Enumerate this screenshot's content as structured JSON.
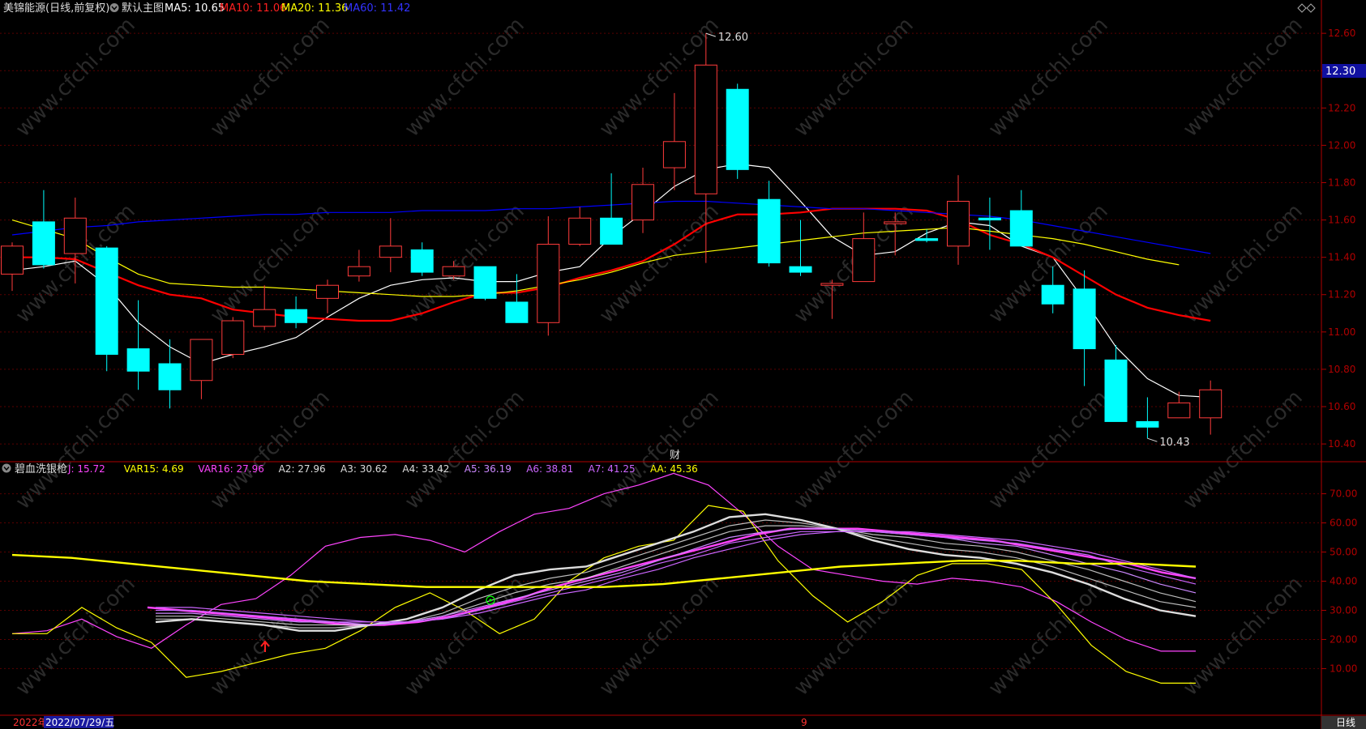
{
  "colors": {
    "bg": "#000000",
    "axis": "#b00000",
    "grid": "#5a0000",
    "up": "#ff3b3b",
    "down": "#00ffff",
    "ma5": "#ffffff",
    "ma10": "#ff0000",
    "ma20": "#ffff00",
    "ma60": "#0000ff",
    "label": "#dddddd",
    "pricebox": "#1010a0",
    "watermark": "#2a2a2a"
  },
  "watermark": "www.cfchi.com",
  "top_header": {
    "title": "美锦能源(日线,前复权)",
    "template": "默认主图",
    "ma5_text": "MA5: 10.65",
    "ma10_text": "MA10: 11.06",
    "ma20_text": "MA20: 11.36",
    "ma60_text": "MA60: 11.42"
  },
  "bottom_header": {
    "title": "碧血洗银枪",
    "items": [
      {
        "text": "J: 15.72",
        "color": "#ff44ff"
      },
      {
        "text": "VAR15: 4.69",
        "color": "#ffff00"
      },
      {
        "text": "VAR16: 27.96",
        "color": "#ff44ff"
      },
      {
        "text": "A2: 27.96",
        "color": "#dddddd"
      },
      {
        "text": "A3: 30.62",
        "color": "#dddddd"
      },
      {
        "text": "A4: 33.42",
        "color": "#dddddd"
      },
      {
        "text": "A5: 36.19",
        "color": "#cc88ff"
      },
      {
        "text": "A6: 38.81",
        "color": "#cc66ff"
      },
      {
        "text": "A7: 41.25",
        "color": "#cc66ff"
      },
      {
        "text": "AA: 45.36",
        "color": "#ffff00"
      }
    ]
  },
  "current_price_tag": "12.30",
  "high_annotation": "12.60",
  "low_annotation": "10.43",
  "cai_marker": "财",
  "date_bar": {
    "year": "2022年",
    "date": "2022/07/29/五",
    "month_marker": "9",
    "period": "日线"
  },
  "chart_data": [
    {
      "type": "candlestick",
      "title": "美锦能源(日线,前复权)",
      "y_ticks": [
        "10.40",
        "10.60",
        "10.80",
        "11.00",
        "11.20",
        "11.40",
        "11.60",
        "11.80",
        "12.00",
        "12.20",
        "12.40",
        "12.60"
      ],
      "ylim": [
        10.37,
        12.67
      ],
      "grid": true,
      "candles": [
        {
          "o": 11.31,
          "h": 11.48,
          "l": 11.22,
          "c": 11.46
        },
        {
          "o": 11.59,
          "h": 11.76,
          "l": 11.34,
          "c": 11.36
        },
        {
          "o": 11.42,
          "h": 11.72,
          "l": 11.26,
          "c": 11.61
        },
        {
          "o": 11.45,
          "h": 11.46,
          "l": 10.79,
          "c": 10.88
        },
        {
          "o": 10.91,
          "h": 11.17,
          "l": 10.69,
          "c": 10.79
        },
        {
          "o": 10.83,
          "h": 10.96,
          "l": 10.59,
          "c": 10.69
        },
        {
          "o": 10.74,
          "h": 10.96,
          "l": 10.64,
          "c": 10.96
        },
        {
          "o": 10.88,
          "h": 11.08,
          "l": 10.86,
          "c": 11.06
        },
        {
          "o": 11.03,
          "h": 11.25,
          "l": 11.01,
          "c": 11.12
        },
        {
          "o": 11.12,
          "h": 11.19,
          "l": 11.02,
          "c": 11.05
        },
        {
          "o": 11.18,
          "h": 11.28,
          "l": 11.1,
          "c": 11.25
        },
        {
          "o": 11.3,
          "h": 11.44,
          "l": 11.27,
          "c": 11.35
        },
        {
          "o": 11.4,
          "h": 11.61,
          "l": 11.32,
          "c": 11.46
        },
        {
          "o": 11.44,
          "h": 11.48,
          "l": 11.3,
          "c": 11.32
        },
        {
          "o": 11.3,
          "h": 11.38,
          "l": 11.28,
          "c": 11.35
        },
        {
          "o": 11.35,
          "h": 11.35,
          "l": 11.17,
          "c": 11.18
        },
        {
          "o": 11.16,
          "h": 11.31,
          "l": 11.05,
          "c": 11.05
        },
        {
          "o": 11.05,
          "h": 11.62,
          "l": 10.98,
          "c": 11.47
        },
        {
          "o": 11.47,
          "h": 11.67,
          "l": 11.46,
          "c": 11.61
        },
        {
          "o": 11.61,
          "h": 11.85,
          "l": 11.47,
          "c": 11.47
        },
        {
          "o": 11.6,
          "h": 11.88,
          "l": 11.53,
          "c": 11.79
        },
        {
          "o": 11.88,
          "h": 12.28,
          "l": 11.76,
          "c": 12.02
        },
        {
          "o": 11.74,
          "h": 12.6,
          "l": 11.37,
          "c": 12.43
        },
        {
          "o": 12.3,
          "h": 12.33,
          "l": 11.82,
          "c": 11.87
        },
        {
          "o": 11.71,
          "h": 11.81,
          "l": 11.35,
          "c": 11.37
        },
        {
          "o": 11.35,
          "h": 11.6,
          "l": 11.3,
          "c": 11.32
        },
        {
          "o": 11.25,
          "h": 11.28,
          "l": 11.07,
          "c": 11.26
        },
        {
          "o": 11.27,
          "h": 11.64,
          "l": 11.27,
          "c": 11.5
        },
        {
          "o": 11.58,
          "h": 11.64,
          "l": 11.41,
          "c": 11.59
        },
        {
          "o": 11.5,
          "h": 11.55,
          "l": 11.48,
          "c": 11.49
        },
        {
          "o": 11.46,
          "h": 11.84,
          "l": 11.36,
          "c": 11.7
        },
        {
          "o": 11.61,
          "h": 11.72,
          "l": 11.44,
          "c": 11.6
        },
        {
          "o": 11.65,
          "h": 11.76,
          "l": 11.46,
          "c": 11.46
        },
        {
          "o": 11.25,
          "h": 11.35,
          "l": 11.1,
          "c": 11.15
        },
        {
          "o": 11.23,
          "h": 11.33,
          "l": 10.71,
          "c": 10.91
        },
        {
          "o": 10.85,
          "h": 10.93,
          "l": 10.52,
          "c": 10.52
        },
        {
          "o": 10.52,
          "h": 10.65,
          "l": 10.43,
          "c": 10.49
        },
        {
          "o": 10.54,
          "h": 10.68,
          "l": 10.54,
          "c": 10.62
        },
        {
          "o": 10.54,
          "h": 10.74,
          "l": 10.45,
          "c": 10.69
        }
      ],
      "series": [
        {
          "name": "MA5",
          "color": "#ffffff",
          "values": [
            11.33,
            11.35,
            11.38,
            11.25,
            11.05,
            10.92,
            10.83,
            10.88,
            10.92,
            10.97,
            11.08,
            11.18,
            11.25,
            11.28,
            11.29,
            11.27,
            11.27,
            11.32,
            11.35,
            11.51,
            11.64,
            11.78,
            11.87,
            11.9,
            11.88,
            11.7,
            11.51,
            11.41,
            11.43,
            11.53,
            11.59,
            11.57,
            11.46,
            11.4,
            11.17,
            10.92,
            10.75,
            10.66,
            10.65
          ]
        },
        {
          "name": "MA10",
          "color": "#ff0000",
          "values": [
            11.4,
            11.4,
            11.39,
            11.32,
            11.25,
            11.2,
            11.18,
            11.12,
            11.1,
            11.08,
            11.07,
            11.06,
            11.06,
            11.1,
            11.16,
            11.21,
            11.21,
            11.24,
            11.29,
            11.33,
            11.38,
            11.47,
            11.58,
            11.63,
            11.63,
            11.64,
            11.66,
            11.66,
            11.66,
            11.65,
            11.6,
            11.52,
            11.47,
            11.4,
            11.3,
            11.2,
            11.13,
            11.09,
            11.06
          ]
        },
        {
          "name": "MA20",
          "color": "#ffff00",
          "values": [
            11.6,
            11.55,
            11.5,
            11.4,
            11.31,
            11.26,
            11.25,
            11.24,
            11.24,
            11.23,
            11.22,
            11.21,
            11.2,
            11.19,
            11.19,
            11.2,
            11.22,
            11.25,
            11.28,
            11.32,
            11.37,
            11.41,
            11.43,
            11.45,
            11.47,
            11.49,
            11.51,
            11.53,
            11.54,
            11.55,
            11.56,
            11.54,
            11.52,
            11.5,
            11.47,
            11.43,
            11.39,
            11.36
          ]
        },
        {
          "name": "MA60",
          "color": "#0000ff",
          "values": [
            11.52,
            11.54,
            11.56,
            11.57,
            11.59,
            11.6,
            11.61,
            11.62,
            11.63,
            11.63,
            11.64,
            11.64,
            11.64,
            11.65,
            11.65,
            11.65,
            11.66,
            11.66,
            11.67,
            11.68,
            11.69,
            11.7,
            11.7,
            11.69,
            11.68,
            11.67,
            11.66,
            11.66,
            11.65,
            11.64,
            11.63,
            11.62,
            11.6,
            11.57,
            11.54,
            11.51,
            11.48,
            11.45,
            11.42
          ]
        }
      ]
    },
    {
      "type": "line",
      "title": "碧血洗银枪",
      "y_ticks": [
        "10.00",
        "20.00",
        "30.00",
        "40.00",
        "50.00",
        "60.00",
        "70.00"
      ],
      "ylim": [
        -6,
        81
      ],
      "grid": true,
      "series": [
        {
          "name": "J",
          "color": "#ff44ff",
          "values": [
            22,
            23,
            27,
            21,
            17,
            25,
            32,
            34,
            42,
            52,
            55,
            56,
            54,
            50,
            57,
            63,
            65,
            70,
            73,
            77,
            73,
            63,
            52,
            44,
            42,
            40,
            39,
            41,
            40,
            38,
            33,
            26,
            20,
            16,
            16
          ]
        },
        {
          "name": "VAR15",
          "color": "#ffff00",
          "values": [
            22,
            22,
            31,
            24,
            19,
            7,
            9,
            12,
            15,
            17,
            23,
            31,
            36,
            30,
            22,
            27,
            40,
            48,
            52,
            54,
            66,
            64,
            47,
            35,
            26,
            33,
            42,
            46,
            46,
            44,
            32,
            18,
            9,
            5,
            5
          ]
        },
        {
          "name": "VAR16",
          "color": "#ff44ff",
          "values": [
            31,
            30,
            29,
            28,
            27,
            26,
            25,
            25,
            26,
            28,
            31,
            34,
            38,
            41,
            44,
            47,
            50,
            53,
            56,
            58,
            58,
            58,
            57,
            56,
            55,
            54,
            52,
            50,
            48,
            46,
            43,
            41
          ]
        },
        {
          "name": "A2",
          "color": "#dddddd",
          "values": [
            26,
            27,
            26,
            25,
            23,
            23,
            25,
            27,
            31,
            37,
            42,
            44,
            45,
            49,
            53,
            57,
            62,
            63,
            61,
            58,
            54,
            51,
            49,
            48,
            46,
            43,
            39,
            34,
            30,
            28
          ]
        },
        {
          "name": "A3",
          "color": "#dddddd",
          "values": [
            27,
            27,
            26,
            25,
            24,
            24,
            25,
            26,
            29,
            34,
            38,
            41,
            43,
            47,
            51,
            55,
            59,
            61,
            60,
            58,
            55,
            53,
            51,
            50,
            48,
            45,
            41,
            37,
            33,
            31
          ]
        },
        {
          "name": "A4",
          "color": "#dddddd",
          "values": [
            28,
            28,
            27,
            26,
            25,
            25,
            25,
            26,
            28,
            32,
            36,
            39,
            41,
            45,
            49,
            53,
            57,
            59,
            59,
            58,
            56,
            55,
            53,
            52,
            50,
            47,
            44,
            40,
            36,
            33
          ]
        },
        {
          "name": "A5",
          "color": "#cc88ff",
          "values": [
            29,
            29,
            28,
            27,
            26,
            26,
            25,
            26,
            28,
            31,
            34,
            37,
            40,
            43,
            47,
            51,
            55,
            57,
            58,
            58,
            57,
            56,
            55,
            53,
            52,
            49,
            46,
            43,
            39,
            36
          ]
        },
        {
          "name": "A6",
          "color": "#cc66ff",
          "values": [
            30,
            30,
            29,
            28,
            27,
            26,
            26,
            26,
            27,
            30,
            33,
            36,
            39,
            42,
            46,
            49,
            53,
            55,
            57,
            57,
            57,
            56,
            55,
            54,
            53,
            51,
            49,
            45,
            42,
            39
          ]
        },
        {
          "name": "A7",
          "color": "#cc66ff",
          "values": [
            31,
            31,
            30,
            29,
            28,
            27,
            26,
            26,
            27,
            29,
            32,
            35,
            37,
            41,
            44,
            48,
            51,
            54,
            56,
            57,
            57,
            57,
            56,
            55,
            54,
            52,
            50,
            47,
            44,
            41
          ]
        },
        {
          "name": "AA",
          "color": "#ffff00",
          "values": [
            49,
            48,
            46,
            44,
            42,
            40,
            39,
            38,
            38,
            38,
            38,
            39,
            41,
            43,
            45,
            46,
            47,
            47,
            46,
            46,
            45
          ]
        }
      ]
    }
  ]
}
